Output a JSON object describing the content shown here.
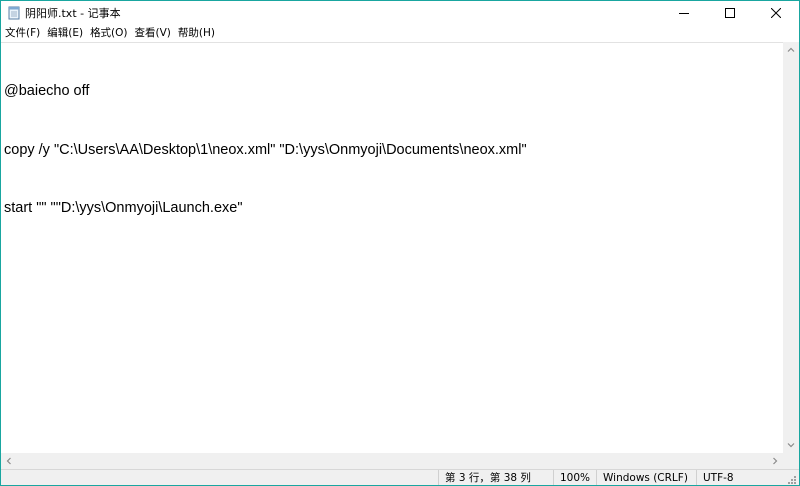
{
  "window": {
    "title": "阴阳师.txt - 记事本",
    "accent_color": "#19a6a0",
    "icons": {
      "app": "notepad-icon",
      "minimize": "minimize-icon",
      "maximize": "maximize-icon",
      "close": "close-icon"
    }
  },
  "menu": {
    "items": [
      "文件(F)",
      "编辑(E)",
      "格式(O)",
      "查看(V)",
      "帮助(H)"
    ]
  },
  "editor": {
    "lines": [
      "@baiecho off",
      "copy /y \"C:\\Users\\AA\\Desktop\\1\\neox.xml\" \"D:\\yys\\Onmyoji\\Documents\\neox.xml\"",
      "start \"\" \"\"D:\\yys\\Onmyoji\\Launch.exe\""
    ]
  },
  "statusbar": {
    "position": "第 3 行，第 38 列",
    "zoom": "100%",
    "line_ending": "Windows (CRLF)",
    "encoding": "UTF-8"
  }
}
